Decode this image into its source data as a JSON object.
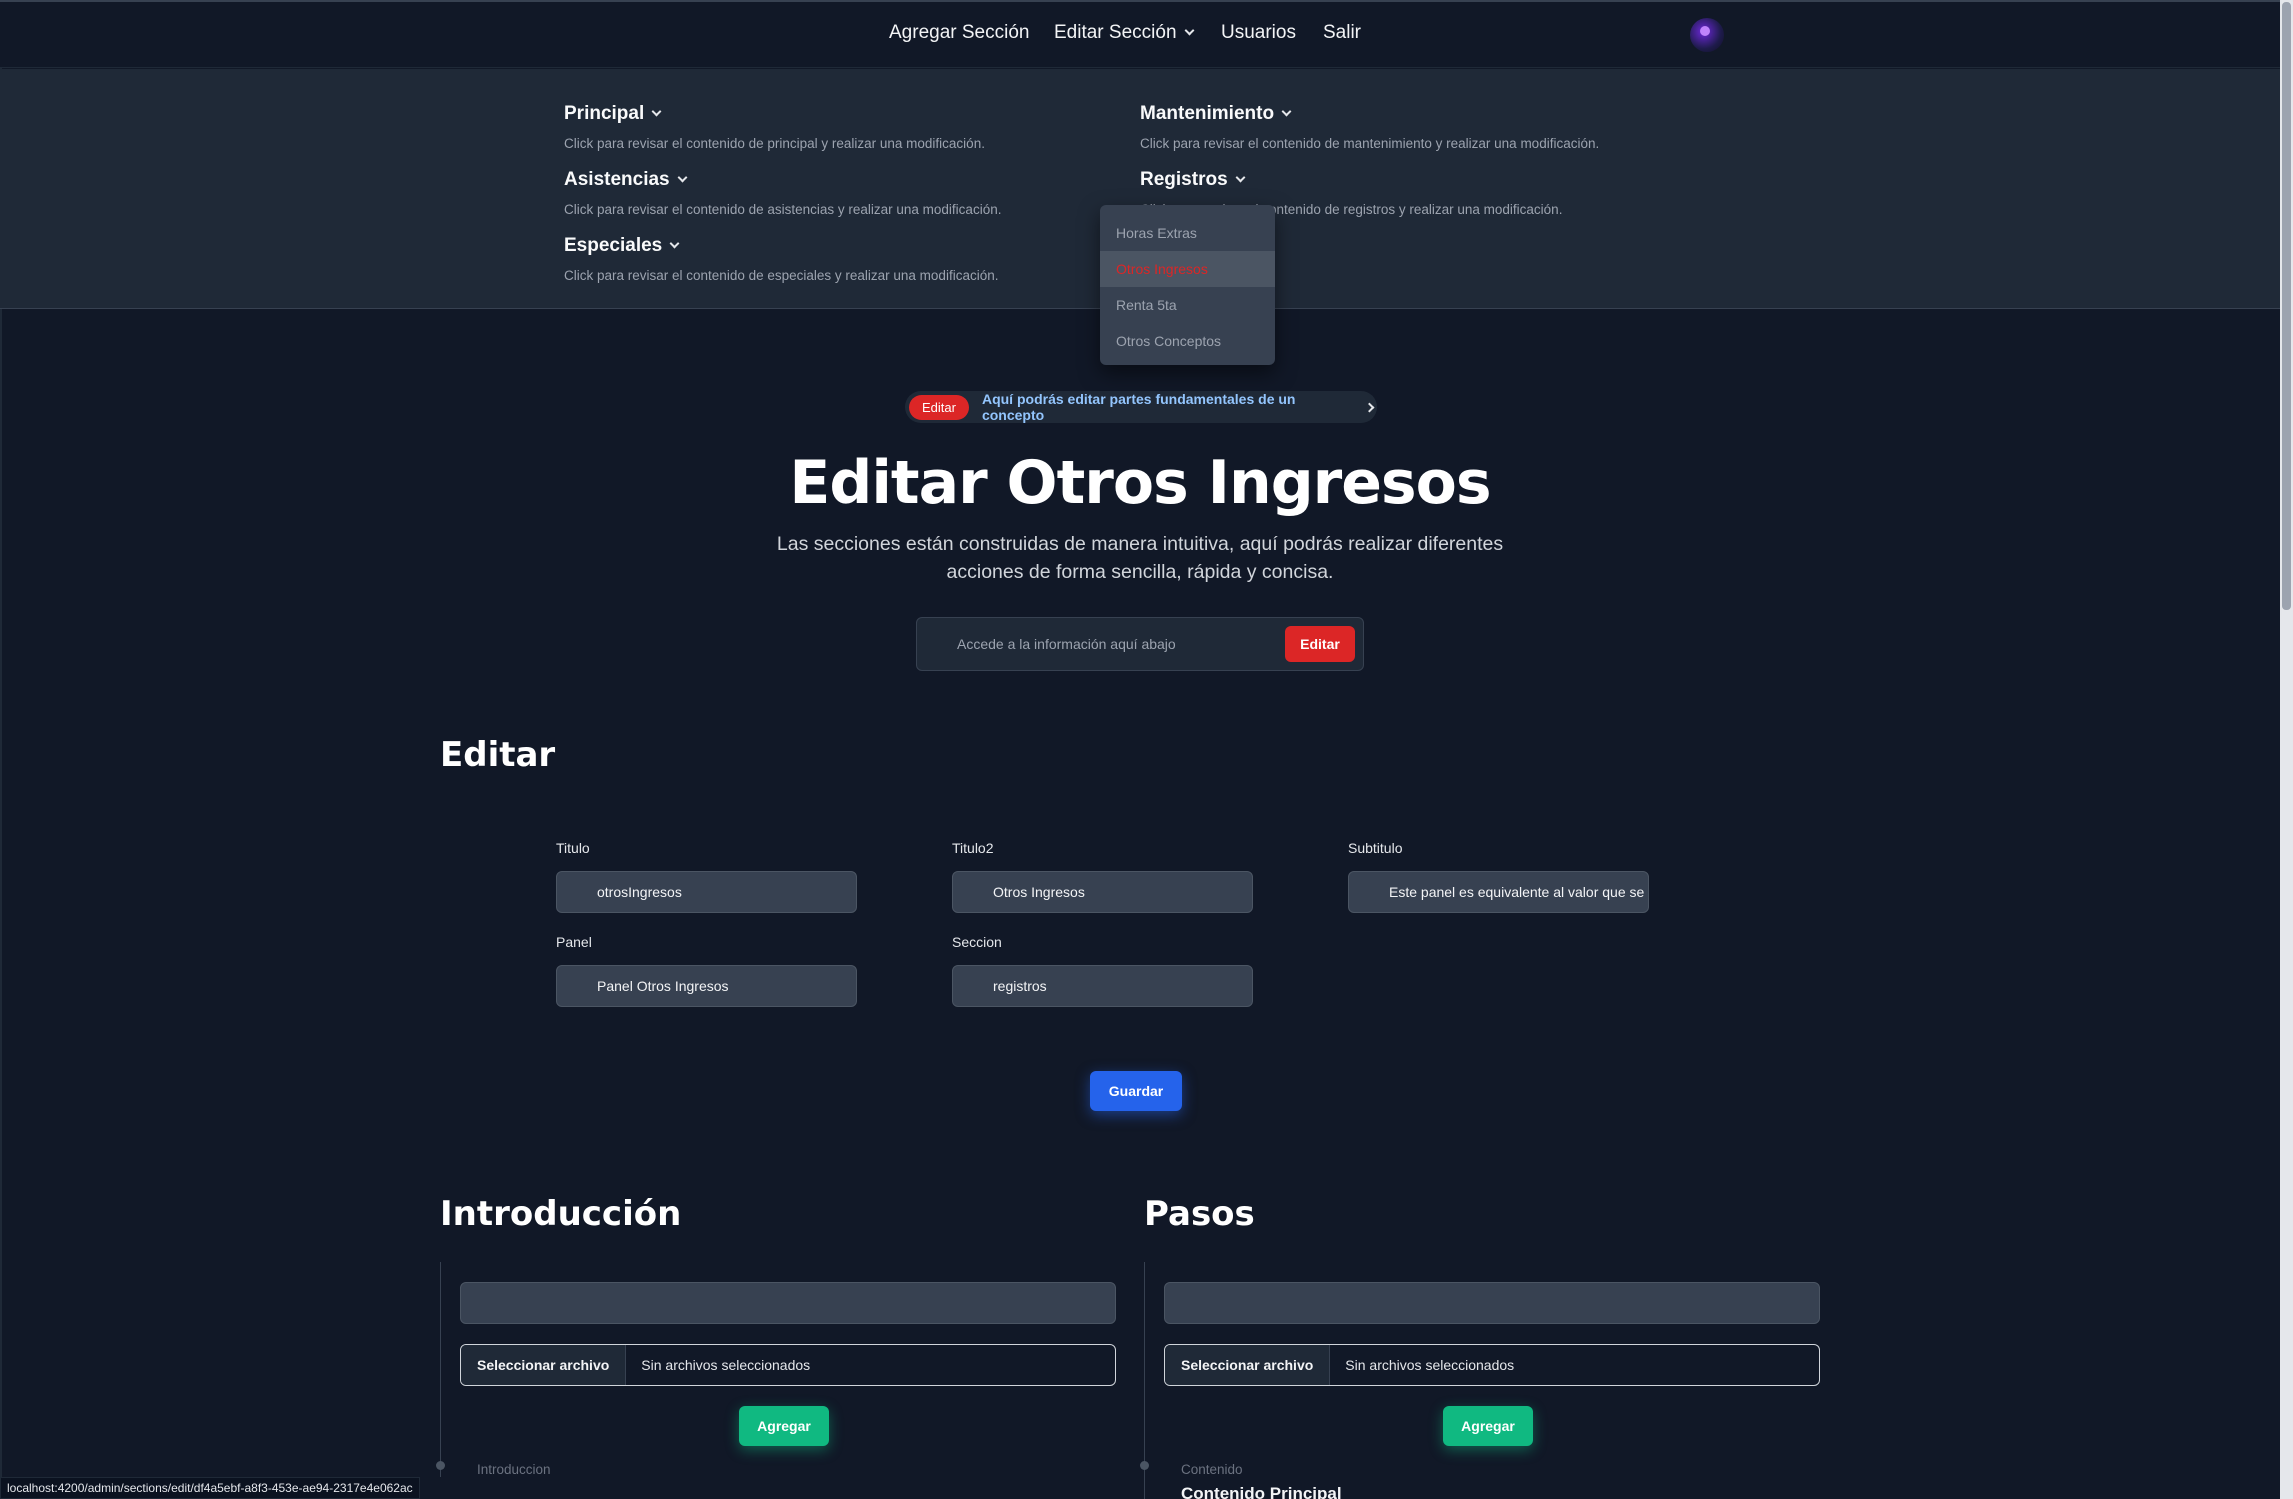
{
  "nav": {
    "items": [
      "Agregar Sección",
      "Editar Sección",
      "Usuarios",
      "Salir"
    ]
  },
  "megamenu": {
    "sections": [
      {
        "title": "Principal",
        "desc": "Click para revisar el contenido de principal y realizar una modificación."
      },
      {
        "title": "Asistencias",
        "desc": "Click para revisar el contenido de asistencias y realizar una modificación."
      },
      {
        "title": "Especiales",
        "desc": "Click para revisar el contenido de especiales y realizar una modificación."
      },
      {
        "title": "Mantenimiento",
        "desc": "Click para revisar el contenido de mantenimiento y realizar una modificación."
      },
      {
        "title": "Registros",
        "desc": "Click para revisar el contenido de registros y realizar una modificación."
      }
    ],
    "dropdown": [
      "Horas Extras",
      "Otros Ingresos",
      "Renta 5ta",
      "Otros Conceptos"
    ],
    "dropdown_active": "Otros Ingresos"
  },
  "hero": {
    "badge": "Editar",
    "banner": "Aquí podrás editar partes fundamentales de un concepto",
    "title": "Editar Otros Ingresos",
    "subtitle": "Las secciones están construidas de manera intuitiva, aquí podrás realizar diferentes acciones de forma sencilla, rápida y concisa.",
    "access_text": "Accede a la información aquí abajo",
    "access_button": "Editar"
  },
  "edit": {
    "heading": "Editar",
    "fields": [
      {
        "label": "Titulo",
        "value": "otrosIngresos"
      },
      {
        "label": "Titulo2",
        "value": "Otros Ingresos"
      },
      {
        "label": "Subtitulo",
        "value": "Este panel es equivalente al valor que se"
      },
      {
        "label": "Panel",
        "value": "Panel Otros Ingresos"
      },
      {
        "label": "Seccion",
        "value": "registros"
      }
    ],
    "save_label": "Guardar"
  },
  "intro": {
    "heading": "Introducción",
    "file_button": "Seleccionar archivo",
    "file_status": "Sin archivos seleccionados",
    "add_label": "Agregar",
    "timeline_label": "Introduccion"
  },
  "steps": {
    "heading": "Pasos",
    "file_button": "Seleccionar archivo",
    "file_status": "Sin archivos seleccionados",
    "add_label": "Agregar",
    "timeline_label": "Contenido",
    "timeline_title": "Contenido Principal"
  },
  "status_url": "localhost:4200/admin/sections/edit/df4a5ebf-a8f3-453e-ae94-2317e4e062ac",
  "colors": {
    "background": "#111827",
    "panel": "#1f2937",
    "accent_red": "#dc2626",
    "accent_blue": "#2563eb",
    "accent_green": "#10b981"
  }
}
